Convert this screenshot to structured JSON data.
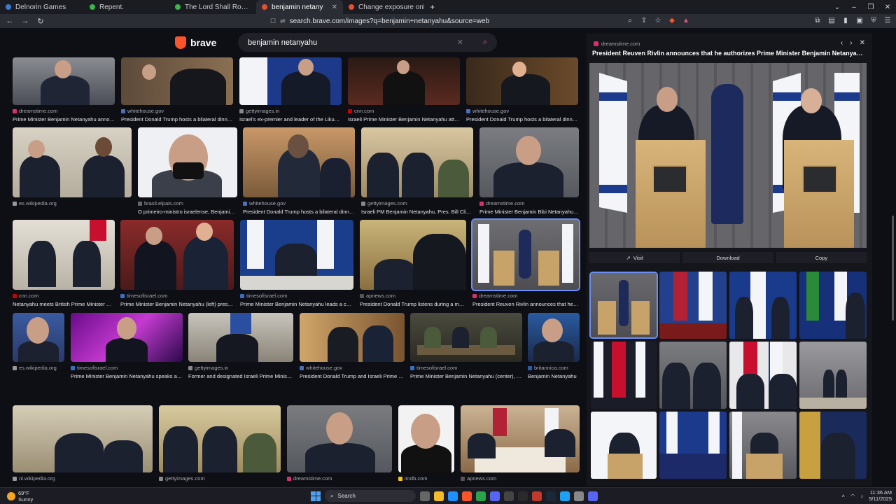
{
  "tabs": [
    {
      "label": "Delnorin Games",
      "color": "#3a7bd5",
      "active": false
    },
    {
      "label": "Repent.",
      "color": "#3bb54a",
      "active": false
    },
    {
      "label": "The Lord Shall Roar: Christians Asleep",
      "color": "#3bb54a",
      "active": false
    },
    {
      "label": "benjamin netanyahu - Brave Sear",
      "color": "#e94e2f",
      "active": true
    },
    {
      "label": "Change exposure online",
      "color": "#e94e2f",
      "active": false
    }
  ],
  "address": {
    "url": "search.brave.com/images?q=benjamin+netanyahu&source=web"
  },
  "brand": {
    "name": "brave"
  },
  "search": {
    "query": "benjamin netanyahu"
  },
  "results": [
    [
      {
        "source": "dreamstime.com",
        "caption": "Prime Minister Benjamin Netanyahu announ...",
        "color": "#d9306a"
      },
      {
        "source": "whitehouse.gov",
        "caption": "President Donald Trump hosts a bilateral dinner f...",
        "color": "#4c6fb5"
      },
      {
        "source": "gettyimages.in",
        "caption": "Israel's ex-premier and leader of the Likud ...",
        "color": "#888"
      },
      {
        "source": "cnn.com",
        "caption": "Israeli Prime Minister Benjamin Netanyahu atten...",
        "color": "#cc0000"
      },
      {
        "source": "whitehouse.gov",
        "caption": "President Donald Trump hosts a bilateral dinner f...",
        "color": "#4c6fb5"
      }
    ],
    [
      {
        "source": "es.wikipedia.org",
        "caption": "",
        "color": "#999"
      },
      {
        "source": "brasil.elpais.com",
        "caption": "O primeiro-ministro israelense, Benjamin N...",
        "color": "#666"
      },
      {
        "source": "whitehouse.gov",
        "caption": "President Donald Trump hosts a bilateral dinner ...",
        "color": "#4c6fb5"
      },
      {
        "source": "gettyimages.com",
        "caption": "Israeli PM Benjamin Netanyahu, Pres. Bill Clinton ...",
        "color": "#888"
      },
      {
        "source": "dreamstime.com",
        "caption": "Prime Minister Benjamin Bibi Netanyahu a...",
        "color": "#d9306a"
      }
    ],
    [
      {
        "source": "cnn.com",
        "caption": "Netanyahu meets British Prime Minister Bor...",
        "color": "#cc0000"
      },
      {
        "source": "timesofisrael.com",
        "caption": "Prime Minister Benjamin Netanyahu (left) present...",
        "color": "#3a6fc2"
      },
      {
        "source": "timesofisrael.com",
        "caption": "Prime Minister Benjamin Netanyahu leads a cabin...",
        "color": "#3a6fc2"
      },
      {
        "source": "apnews.com",
        "caption": "President Donald Trump listens during a meeti...",
        "color": "#555"
      },
      {
        "source": "dreamstime.com",
        "caption": "President Reuven Rivlin announces that he au...",
        "color": "#d9306a"
      }
    ],
    [
      {
        "source": "es.wikipedia.org",
        "caption": "",
        "color": "#999"
      },
      {
        "source": "timesofisrael.com",
        "caption": "Prime Minister Benjamin Netanyahu speaks at th...",
        "color": "#3a6fc2"
      },
      {
        "source": "gettyimages.in",
        "caption": "Former and designated Israeli Prime Minister ...",
        "color": "#888"
      },
      {
        "source": "whitehouse.gov",
        "caption": "President Donald Trump and Israeli Prime Mi...",
        "color": "#4c6fb5"
      },
      {
        "source": "timesofisrael.com",
        "caption": "Prime Minister Benjamin Netanyahu (center), De...",
        "color": "#3a6fc2"
      },
      {
        "source": "britannica.com",
        "caption": "Benjamin Netanyahu",
        "color": "#2a5caa"
      }
    ],
    [
      {
        "source": "nl.wikipedia.org",
        "caption": "",
        "color": "#999"
      },
      {
        "source": "gettyimages.com",
        "caption": "",
        "color": "#888"
      },
      {
        "source": "dreamstime.com",
        "caption": "",
        "color": "#d9306a"
      },
      {
        "source": "imdb.com",
        "caption": "",
        "color": "#f5c518"
      },
      {
        "source": "apnews.com",
        "caption": "",
        "color": "#555"
      }
    ]
  ],
  "panel": {
    "source": "dreamstime.com",
    "title": "President Reuven Rivlin announces that he authorizes Prime Minister Benjamin Netanyahu...",
    "visit": "Visit",
    "download": "Download",
    "copy": "Copy"
  },
  "taskbar": {
    "temp": "69°F",
    "weather": "Sunny",
    "search": "Search",
    "time": "11:36 AM",
    "date": "9/11/2025"
  }
}
